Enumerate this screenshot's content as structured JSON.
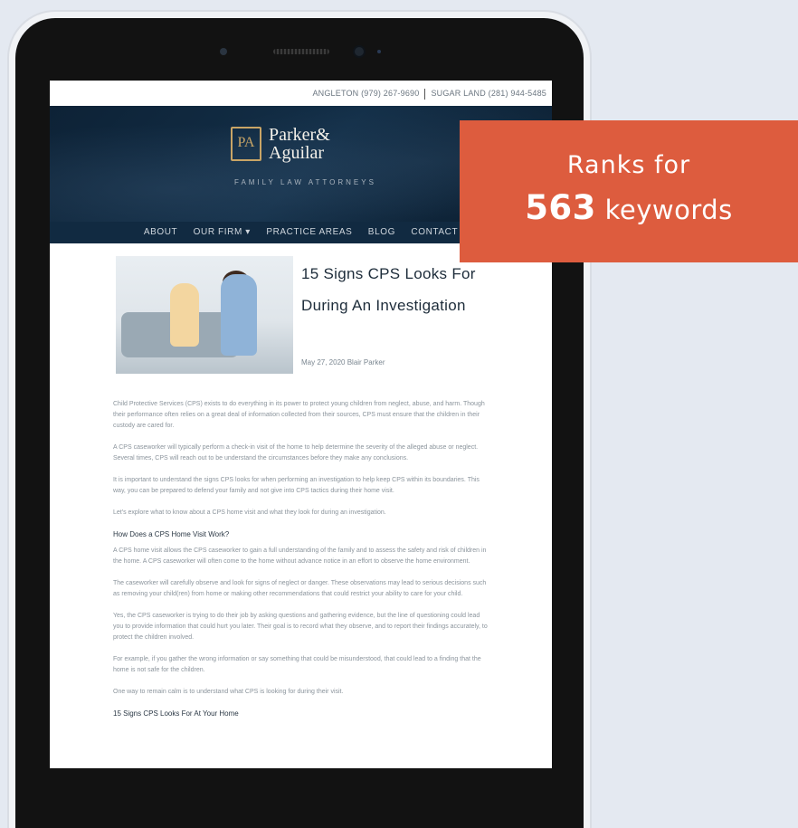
{
  "site": {
    "phones": [
      "ANGLETON (979) 267-9690",
      "SUGAR LAND (281) 944-5485"
    ],
    "logo_mark": "PA",
    "logo_name_line1": "Parker&",
    "logo_name_line2": "Aguilar",
    "logo_tagline": "FAMILY LAW ATTORNEYS",
    "nav": [
      "ABOUT",
      "OUR FIRM",
      "PRACTICE AREAS",
      "BLOG",
      "CONTACT"
    ]
  },
  "article": {
    "title": "15 Signs CPS Looks For During An Investigation",
    "date_author": "May 27, 2020  Blair Parker",
    "paragraphs": [
      "Child Protective Services (CPS) exists to do everything in its power to protect young children from neglect, abuse, and harm. Though their performance often relies on a great deal of information collected from their sources, CPS must ensure that the children in their custody are cared for.",
      "A CPS caseworker will typically perform a check-in visit of the home to help determine the severity of the alleged abuse or neglect. Several times, CPS will reach out to be understand the circumstances before they make any conclusions.",
      "It is important to understand the signs CPS looks for when performing an investigation to help keep CPS within its boundaries. This way, you can be prepared to defend your family and not give into CPS tactics during their home visit.",
      "Let's explore what to know about a CPS home visit and what they look for during an investigation."
    ],
    "section_heading": "How Does a CPS Home Visit Work?",
    "section_paragraphs": [
      "A CPS home visit allows the CPS caseworker to gain a full understanding of the family and to assess the safety and risk of children in the home. A CPS caseworker will often come to the home without advance notice in an effort to observe the home environment.",
      "The caseworker will carefully observe and look for signs of neglect or danger. These observations may lead to serious decisions such as removing your child(ren) from home or making other recommendations that could restrict your ability to care for your child.",
      "Yes, the CPS caseworker is trying to do their job by asking questions and gathering evidence, but the line of questioning could lead you to provide information that could hurt you later. Their goal is to record what they observe, and to report their findings accurately, to protect the children involved.",
      "For example, if you gather the wrong information or say something that could be misunderstood, that could lead to a finding that the home is not safe for the children.",
      "One way to remain calm is to understand what CPS is looking for during their visit."
    ],
    "list_heading": "15 Signs CPS Looks For At Your Home"
  },
  "badge": {
    "line1": "Ranks for",
    "number": "563",
    "suffix": "keywords"
  }
}
